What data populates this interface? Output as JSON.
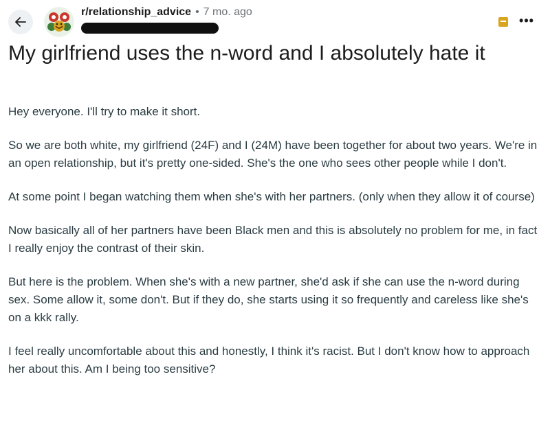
{
  "header": {
    "subreddit": "r/relationship_advice",
    "separator": "•",
    "age": "7 mo. ago",
    "icons": {
      "back": "arrow-left-icon",
      "avatar": "subreddit-avatar-icon",
      "save": "save-icon",
      "more": "more-options-icon"
    },
    "more_label": "•••"
  },
  "post": {
    "title": "My girlfriend uses the n-word and I absolutely hate it",
    "paragraphs": [
      "Hey everyone. I'll try to make it short.",
      "So we are both white, my girlfriend (24F) and I (24M) have been together for about two years. We're in an open relationship, but it's pretty one-sided. She's the one who sees other people while I don't.",
      "At some point I began watching them when she's with her partners. (only when they allow it of course)",
      "Now basically all of her partners have been Black men and this is absolutely no problem for me, in fact I really enjoy the contrast of their skin.",
      "But here is the problem. When she's with a new partner, she'd ask if she can use the n-word during sex. Some allow it, some don't. But if they do, she starts using it so frequently and careless like she's on a kkk rally.",
      "I feel really uncomfortable about this and honestly, I think it's racist. But I don't know how to approach her about this. Am I being too sensitive?"
    ]
  },
  "colors": {
    "text": "#1c1c1c",
    "body_text": "#2a3c42",
    "meta_text": "#6a6f73",
    "save_icon": "#d9a520"
  }
}
